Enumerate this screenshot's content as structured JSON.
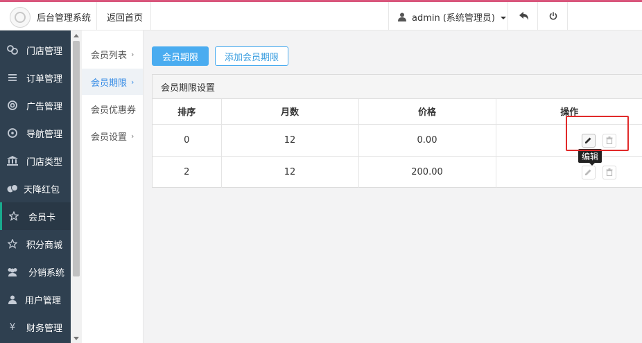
{
  "app": {
    "title": "后台管理系统",
    "home_link": "返回首页"
  },
  "user": {
    "label": "admin (系统管理员)"
  },
  "sidebar": {
    "items": [
      {
        "label": "门店管理",
        "icon": "stores-icon"
      },
      {
        "label": "订单管理",
        "icon": "list-icon"
      },
      {
        "label": "广告管理",
        "icon": "lifebuoy-icon"
      },
      {
        "label": "导航管理",
        "icon": "compass-icon"
      },
      {
        "label": "门店类型",
        "icon": "bank-icon"
      },
      {
        "label": "天降红包",
        "icon": "coins-icon"
      },
      {
        "label": "会员卡",
        "icon": "star-icon",
        "active": true
      },
      {
        "label": "积分商城",
        "icon": "star-icon"
      },
      {
        "label": "分销系统",
        "icon": "users-icon"
      },
      {
        "label": "用户管理",
        "icon": "user-icon"
      },
      {
        "label": "财务管理",
        "icon": "yen-icon"
      }
    ]
  },
  "submenu": {
    "items": [
      {
        "label": "会员列表",
        "has_chevron": true
      },
      {
        "label": "会员期限",
        "has_chevron": true,
        "active": true
      },
      {
        "label": "会员优惠券",
        "has_chevron": false
      },
      {
        "label": "会员设置",
        "has_chevron": true
      }
    ]
  },
  "toolbar": {
    "primary_label": "会员期限",
    "add_label": "添加会员期限"
  },
  "panel": {
    "title": "会员期限设置"
  },
  "table": {
    "headers": [
      "排序",
      "月数",
      "价格",
      "操作"
    ],
    "rows": [
      {
        "sort": "0",
        "months": "12",
        "price": "0.00"
      },
      {
        "sort": "2",
        "months": "12",
        "price": "200.00"
      }
    ]
  },
  "tooltip": {
    "text": "编辑"
  },
  "colors": {
    "topbar_accent": "#d9567c",
    "sidebar_bg": "#2f4050",
    "primary": "#4aacf0",
    "highlight": "#e12a2a"
  }
}
